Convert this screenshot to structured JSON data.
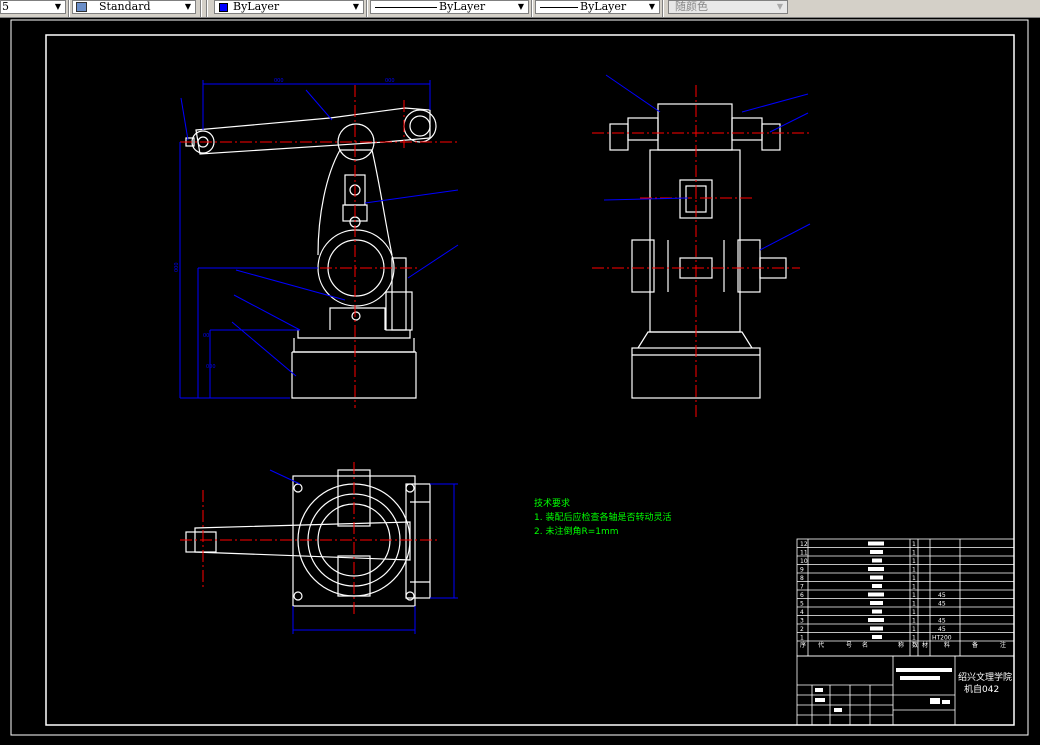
{
  "toolbar": {
    "layer_value": "5",
    "textstyle_value": "Standard",
    "color_value": "ByLayer",
    "linetype_value": "ByLayer",
    "lineweight_value": "ByLayer",
    "plotstyle_value": "随颜色"
  },
  "drawing": {
    "tech_req_title": "技术要求",
    "tech_req_1": "1. 装配后应检查各轴是否转动灵活",
    "tech_req_2": "2. 未注倒角R=1mm",
    "colors": {
      "outline": "#ffffff",
      "center": "#ff0000",
      "dimension": "#0000ff",
      "note": "#00ff00"
    }
  },
  "bom": {
    "rows": [
      {
        "no": "12",
        "qty": "1",
        "mat": ""
      },
      {
        "no": "11",
        "qty": "1",
        "mat": ""
      },
      {
        "no": "10",
        "qty": "1",
        "mat": ""
      },
      {
        "no": "9",
        "qty": "1",
        "mat": ""
      },
      {
        "no": "8",
        "qty": "1",
        "mat": ""
      },
      {
        "no": "7",
        "qty": "1",
        "mat": ""
      },
      {
        "no": "6",
        "qty": "1",
        "mat": "45"
      },
      {
        "no": "5",
        "qty": "1",
        "mat": "45"
      },
      {
        "no": "4",
        "qty": "1",
        "mat": ""
      },
      {
        "no": "3",
        "qty": "1",
        "mat": "45"
      },
      {
        "no": "2",
        "qty": "1",
        "mat": "45"
      },
      {
        "no": "1",
        "qty": "1",
        "mat": "HT200"
      }
    ],
    "header": [
      "序",
      "代",
      "号",
      "名",
      "称",
      "数",
      "材",
      "料",
      "备",
      "注"
    ]
  },
  "titleblock": {
    "school": "绍兴文理学院",
    "class": "机自042"
  }
}
